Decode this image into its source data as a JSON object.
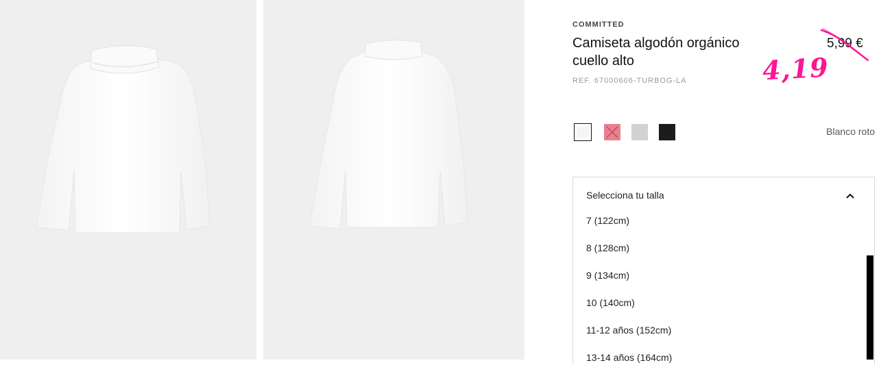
{
  "product": {
    "brand": "COMMITTED",
    "title": "Camiseta algodón orgánico cuello alto",
    "ref": "REF. 67000606-TURBOG-LA",
    "old_price": "5,99 €",
    "sale_price": "4,19"
  },
  "colors": {
    "selected_name": "Blanco roto",
    "swatches": [
      {
        "name": "Blanco roto",
        "hex": "#f5f5f3",
        "selected": true,
        "available": true
      },
      {
        "name": "Rosa",
        "hex": "#e8818e",
        "selected": false,
        "available": false
      },
      {
        "name": "Gris",
        "hex": "#cfcfcf",
        "selected": false,
        "available": true
      },
      {
        "name": "Negro",
        "hex": "#1c1c1c",
        "selected": false,
        "available": true
      }
    ]
  },
  "size_selector": {
    "placeholder": "Selecciona tu talla",
    "options": [
      "7 (122cm)",
      "8 (128cm)",
      "9 (134cm)",
      "10 (140cm)",
      "11-12 años (152cm)",
      "13-14 años (164cm)"
    ]
  },
  "icons": {
    "strike": "strikethrough-scribble",
    "dropdown": "chevron-up-icon",
    "unavailable": "cross-icon"
  },
  "theme": {
    "sale_color": "#ff1493",
    "photo_bg": "#efefef"
  }
}
